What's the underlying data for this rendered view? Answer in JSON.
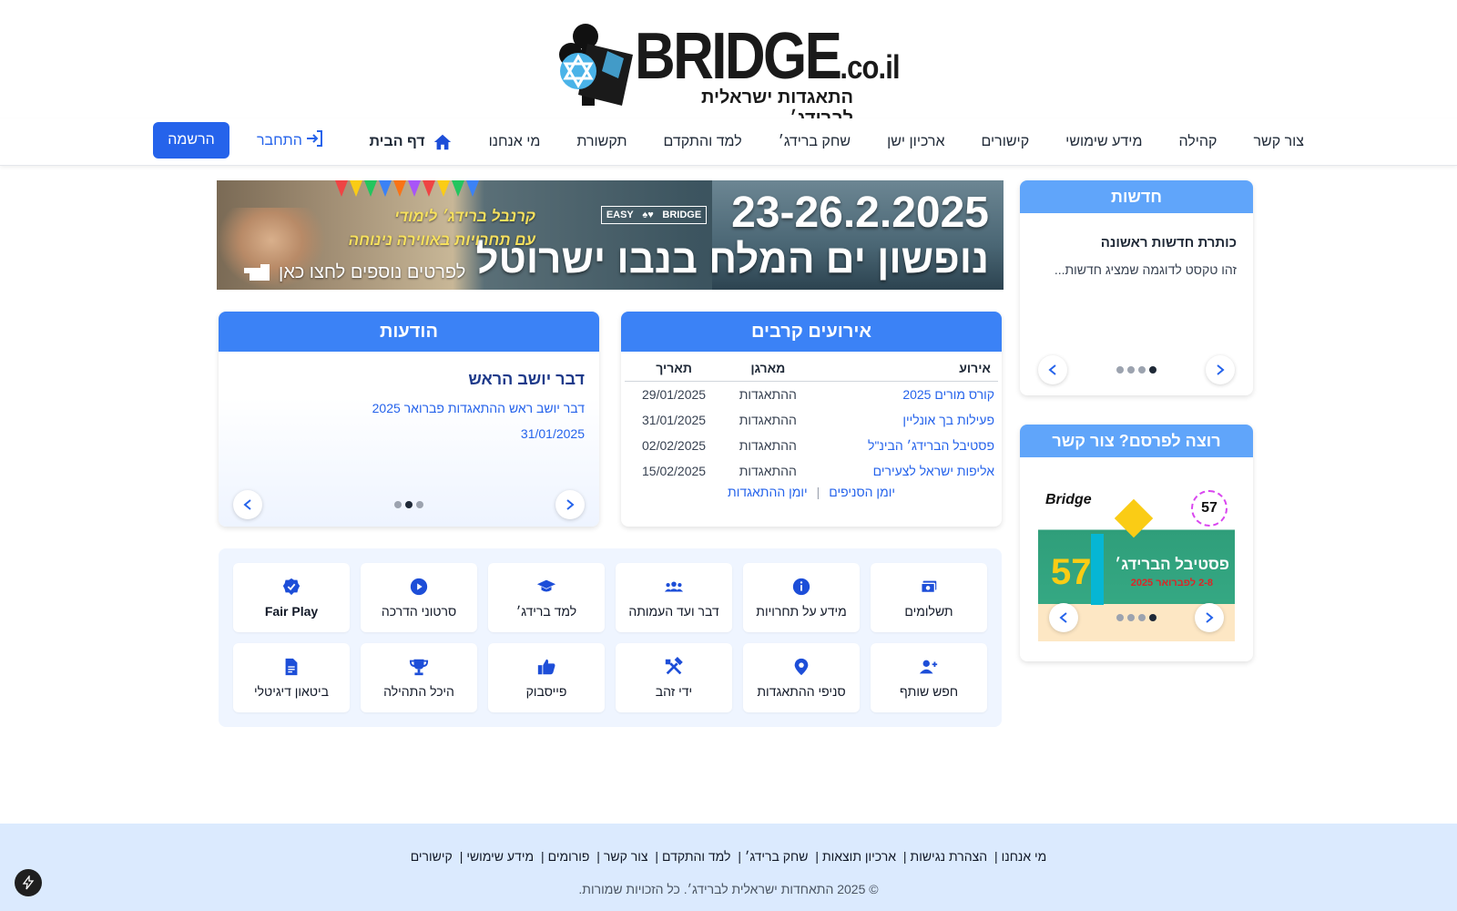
{
  "logo": {
    "wordmark": "BRIDGE",
    "domain_suffix": ".co.il",
    "tagline": "התאגדות ישראלית לברידג׳"
  },
  "nav": {
    "home": "דף הבית",
    "items": [
      "מי אנחנו",
      "תקשורת",
      "למד והתקדם",
      "שחק ברידג׳",
      "ארכיון ישן",
      "קישורים",
      "מידע שימושי",
      "קהילה",
      "צור קשר"
    ],
    "login": "התחבר",
    "register": "הרשמה"
  },
  "banner": {
    "date": "23-26.2.2025",
    "place": "נופשון ים המלח בנבו ישרוטל",
    "promo_line1": "קרנבל ברידג׳ לימודי",
    "promo_line2": "עם תחרויות באווירה נינוחה",
    "cta": "לפרטים נוספים לחצו כאן",
    "brand_left": "EASY",
    "brand_right": "BRIDGE"
  },
  "news": {
    "header": "חדשות",
    "item_title": "כותרת חדשות ראשונה",
    "item_text": "זהו טקסט לדוגמה שמציג חדשות...",
    "dots": 4,
    "active_dot": 4
  },
  "ad": {
    "header": "רוצה לפרסם? צור קשר",
    "brand": "Bridge",
    "badge": "57",
    "big_number": "57",
    "title": "פסטיבל הברידג׳",
    "subtitle": "2-8 לפברואר 2025",
    "dots": 4,
    "active_dot": 4
  },
  "announcements": {
    "header": "הודעות",
    "title": "דבר יושב הראש",
    "text": "דבר יושב ראש ההתאגדות פברואר 2025",
    "date": "31/01/2025",
    "dots": 3,
    "active_dot": 2
  },
  "events": {
    "header": "אירועים קרבים",
    "columns": [
      "אירוע",
      "מארגן",
      "תאריך"
    ],
    "rows": [
      {
        "name": "קורס מורים 2025",
        "org": "ההתאגדות",
        "date": "29/01/2025"
      },
      {
        "name": "פעילות בך אונליין",
        "org": "ההתאגדות",
        "date": "31/01/2025"
      },
      {
        "name": "פסטיבל הברידג׳ הבינ\"ל",
        "org": "ההתאגדות",
        "date": "02/02/2025"
      },
      {
        "name": "אליפות ישראל לצעירים",
        "org": "ההתאגדות",
        "date": "15/02/2025"
      }
    ],
    "link_branches": "יומן הסניפים",
    "link_association": "יומן ההתאגדות"
  },
  "tiles": [
    {
      "label": "תשלומים",
      "icon": "payments-icon"
    },
    {
      "label": "מידע על תחרויות",
      "icon": "info-icon"
    },
    {
      "label": "דבר ועד העמותה",
      "icon": "group-icon"
    },
    {
      "label": "למד ברידג׳",
      "icon": "graduation-cap-icon"
    },
    {
      "label": "סרטוני הדרכה",
      "icon": "play-icon"
    },
    {
      "label": "Fair Play",
      "icon": "verified-icon"
    },
    {
      "label": "חפש שותף",
      "icon": "add-user-icon"
    },
    {
      "label": "סניפי ההתאגדות",
      "icon": "location-pin-icon"
    },
    {
      "label": "ידי זהב",
      "icon": "tools-icon"
    },
    {
      "label": "פייסבוק",
      "icon": "thumbs-up-icon"
    },
    {
      "label": "היכל התהילה",
      "icon": "trophy-icon"
    },
    {
      "label": "ביטאון דיגיטלי",
      "icon": "document-icon"
    }
  ],
  "footer": {
    "links": [
      "מי אנחנו",
      "הצהרת נגישות",
      "ארכיון תוצאות",
      "שחק ברידג׳",
      "למד והתקדם",
      "צור קשר",
      "פורומים",
      "מידע שימושי",
      "קישורים"
    ],
    "copyright": "© 2025 התאחדות ישראלית לברידג׳. כל הזכויות שמורות."
  },
  "colors": {
    "primary": "#2563eb",
    "card_header": "#60a5fa",
    "card_header_dark": "#3b82f6",
    "footer_bg": "#dbeafe"
  }
}
